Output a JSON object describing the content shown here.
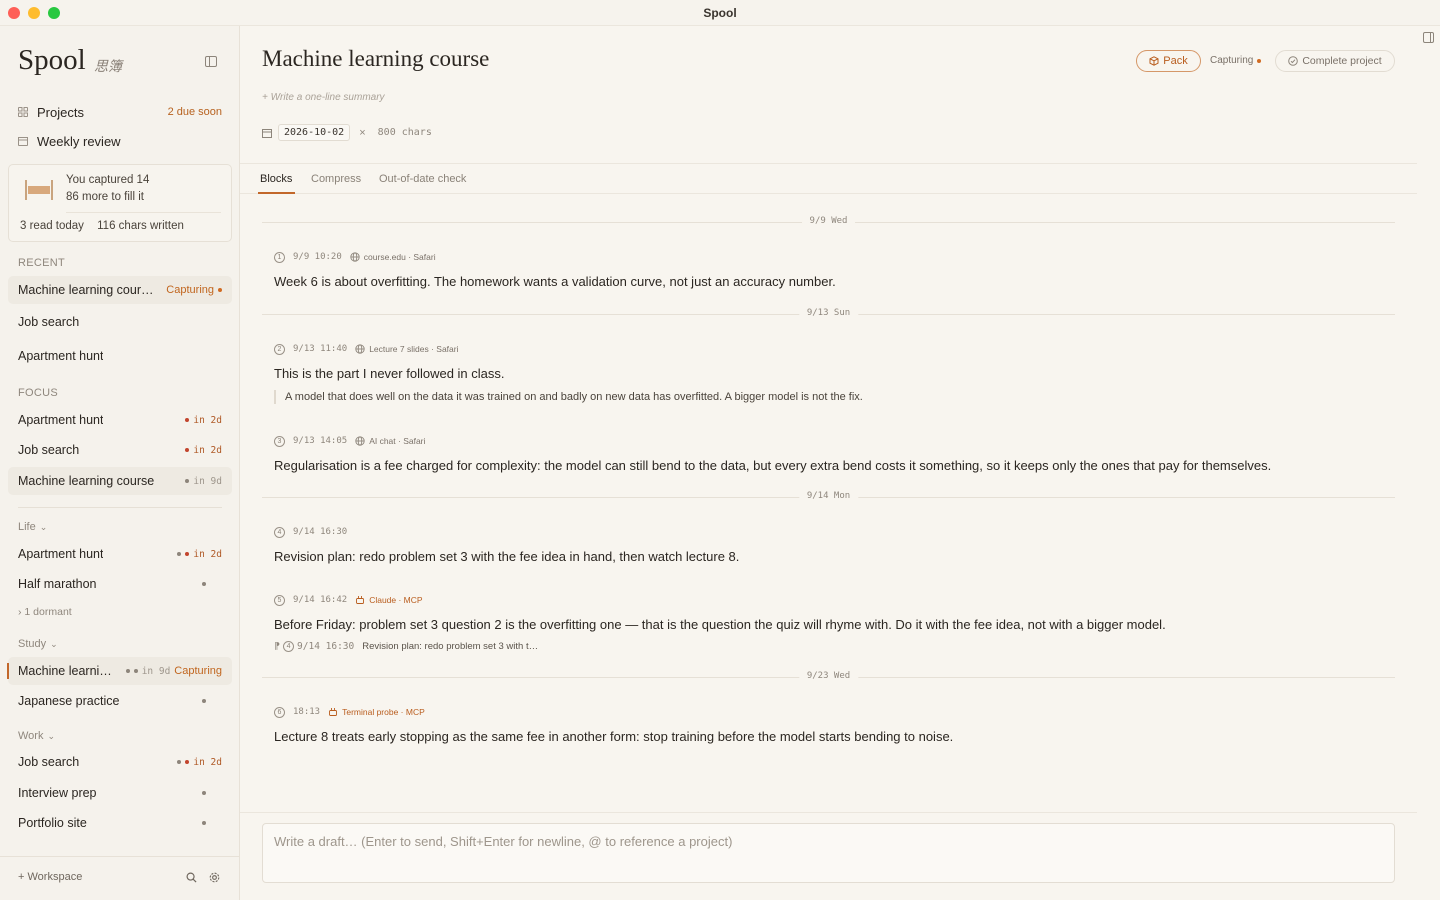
{
  "window": {
    "title": "Spool"
  },
  "sidebar": {
    "brand": "Spool",
    "brand_sub": "思簿",
    "nav": [
      {
        "label": "Projects",
        "badge": "2 due soon"
      },
      {
        "label": "Weekly review",
        "badge": ""
      }
    ],
    "capture": {
      "line1": "You captured 14",
      "line2": "86 more to fill it",
      "fill_fraction": 0.14,
      "read_today": "3 read today",
      "chars_written": "116 chars written"
    },
    "recent": {
      "label": "RECENT",
      "items": [
        {
          "label": "Machine learning cour…",
          "status": "Capturing"
        },
        {
          "label": "Job search"
        },
        {
          "label": "Apartment hunt"
        }
      ]
    },
    "focus": {
      "label": "FOCUS",
      "items": [
        {
          "label": "Apartment hunt",
          "due": "in 2d"
        },
        {
          "label": "Job search",
          "due": "in 2d"
        },
        {
          "label": "Machine learning course",
          "due": "in 9d"
        }
      ]
    },
    "groups": [
      {
        "label": "Life",
        "items": [
          {
            "label": "Apartment hunt",
            "due": "in 2d"
          },
          {
            "label": "Half marathon"
          }
        ],
        "dormant": "1 dormant"
      },
      {
        "label": "Study",
        "items": [
          {
            "label": "Machine learni…",
            "due": "in 9d",
            "status": "Capturing"
          },
          {
            "label": "Japanese practice"
          }
        ]
      },
      {
        "label": "Work",
        "items": [
          {
            "label": "Job search",
            "due": "in 2d"
          },
          {
            "label": "Interview prep"
          },
          {
            "label": "Portfolio site"
          }
        ]
      }
    ],
    "footer": {
      "workspace": "Workspace"
    }
  },
  "main": {
    "title": "Machine learning course",
    "summary_placeholder": "+ Write a one-line summary",
    "date": "2026-10-02",
    "chars": "800 chars",
    "pack_label": "Pack",
    "capturing_label": "Capturing",
    "complete_label": "Complete project",
    "tabs": [
      "Blocks",
      "Compress",
      "Out-of-date check"
    ],
    "days": [
      "9/9 Wed",
      "9/13 Sun",
      "9/14 Mon",
      "9/23 Wed"
    ],
    "blocks": [
      {
        "num": "1",
        "time": "9/9 10:20",
        "source": "course.edu · Safari",
        "text": "Week 6 is about overfitting. The homework wants a validation curve, not just an accuracy number."
      },
      {
        "num": "2",
        "time": "9/13 11:40",
        "source": "Lecture 7 slides · Safari",
        "text": "This is the part I never followed in class.",
        "quote": "A model that does well on the data it was trained on and badly on new data has overfitted. A bigger model is not the fix."
      },
      {
        "num": "3",
        "time": "9/13 14:05",
        "source": "AI chat · Safari",
        "text": "Regularisation is a fee charged for complexity: the model can still bend to the data, but every extra bend costs it something, so it keeps only the ones that pay for themselves."
      },
      {
        "num": "4",
        "time": "9/14 16:30",
        "source": "",
        "text": "Revision plan: redo problem set 3 with the fee idea in hand, then watch lecture 8."
      },
      {
        "num": "5",
        "time": "9/14 16:42",
        "source": "Claude · MCP",
        "text": "Before Friday: problem set 3 question 2 is the overfitting one — that is the question the quiz will rhyme with. Do it with the fee idea, not with a bigger model.",
        "ref": {
          "num": "4",
          "time": "9/14 16:30",
          "text": "Revision plan: redo problem set 3 with t…"
        }
      },
      {
        "num": "6",
        "time": "18:13",
        "source": "Terminal probe · MCP",
        "text": "Lecture 8 treats early stopping as the same fee in another form: stop training before the model starts bending to noise."
      }
    ],
    "composer_placeholder": "Write a draft… (Enter to send, Shift+Enter for newline, @ to reference a project)"
  },
  "colors": {
    "accent": "#c2672a",
    "due": "#c2452d",
    "background": "#f8f5ef"
  },
  "icons": [
    "projects-grid-icon",
    "calendar-icon",
    "sidebar-toggle-icon",
    "globe-icon",
    "mcp-plug-icon",
    "search-icon",
    "gear-icon",
    "check-circle-icon",
    "pack-box-icon",
    "quote-reply-icon"
  ]
}
